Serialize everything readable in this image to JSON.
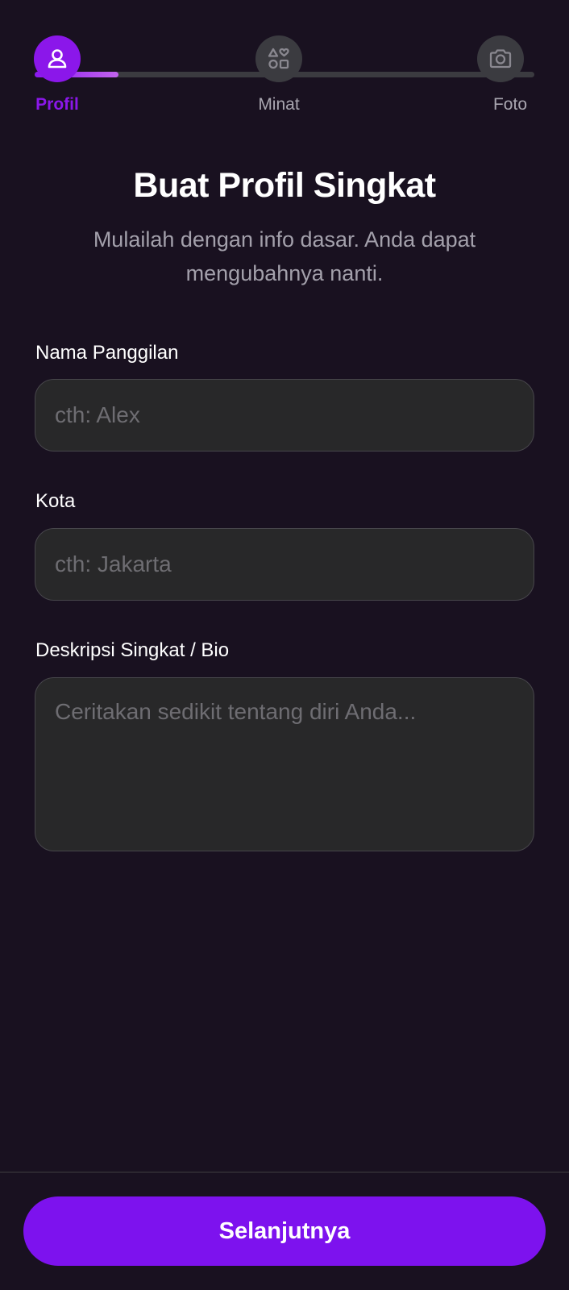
{
  "stepper": {
    "progress": 0.167,
    "steps": [
      {
        "label": "Profil",
        "icon": "user-icon",
        "active": true
      },
      {
        "label": "Minat",
        "icon": "shapes-icon",
        "active": false
      },
      {
        "label": "Foto",
        "icon": "camera-icon",
        "active": false
      }
    ]
  },
  "header": {
    "title": "Buat Profil Singkat",
    "subtitle": "Mulailah dengan info dasar. Anda dapat mengubahnya nanti."
  },
  "form": {
    "nickname": {
      "label": "Nama Panggilan",
      "placeholder": "cth: Alex",
      "value": ""
    },
    "city": {
      "label": "Kota",
      "placeholder": "cth: Jakarta",
      "value": ""
    },
    "bio": {
      "label": "Deskripsi Singkat / Bio",
      "placeholder": "Ceritakan sedikit tentang diri Anda...",
      "value": ""
    }
  },
  "footer": {
    "next_label": "Selanjutnya"
  },
  "colors": {
    "background": "#191120",
    "accent": "#8b17ea",
    "button": "#7d12ee",
    "input_bg": "#282829",
    "inactive": "#3b3b40"
  }
}
